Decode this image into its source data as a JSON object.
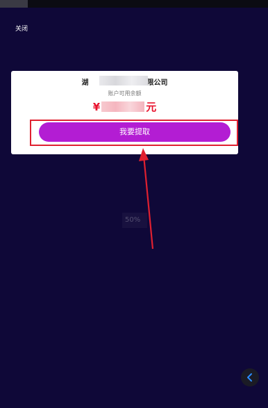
{
  "header": {
    "close_label": "关闭"
  },
  "card": {
    "company_prefix": "湖",
    "company_suffix": "有限公司",
    "balance_label": "账户可用余额",
    "currency_symbol": "¥",
    "amount_suffix": "元",
    "withdraw_button_label": "我要提取"
  },
  "overlay": {
    "loading_text": "50%"
  },
  "icons": {
    "back": "chevron-left-icon",
    "annotation": "red-arrow-icon"
  },
  "colors": {
    "background": "#0f0838",
    "button": "#b31dd3",
    "amount": "#e8112c",
    "annotation": "#e02030"
  }
}
